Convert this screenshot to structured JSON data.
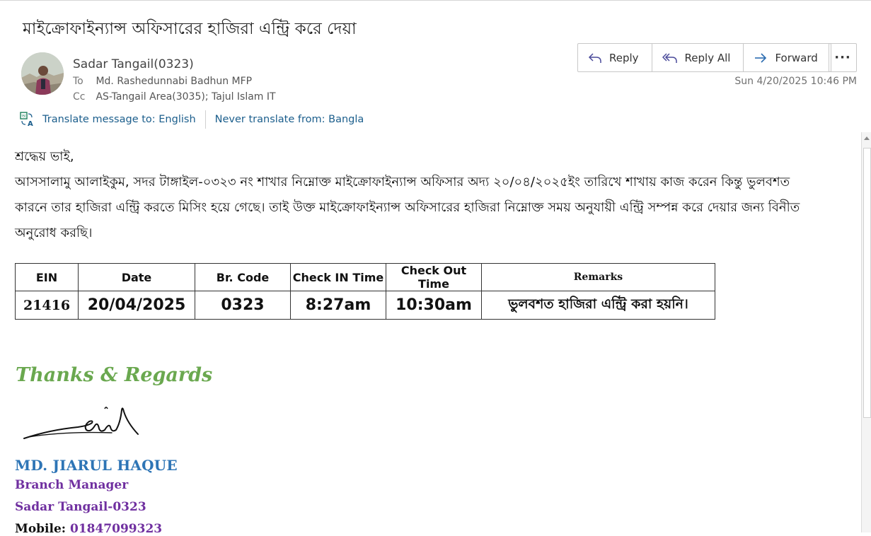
{
  "email": {
    "subject": "মাইক্রোফাইন্যান্স অফিসারের হাজিরা এন্ট্রি করে দেয়া",
    "sender": "Sadar Tangail(0323)",
    "to_label": "To",
    "to_value": "Md. Rashedunnabi Badhun MFP",
    "cc_label": "Cc",
    "cc_value": "AS-Tangail Area(3035); Tajul Islam IT",
    "date": "Sun 4/20/2025 10:46 PM"
  },
  "actions": {
    "reply": "Reply",
    "reply_all": "Reply All",
    "forward": "Forward",
    "more": "···"
  },
  "translate": {
    "translate_to": "Translate message to: English",
    "never_translate": "Never translate from: Bangla"
  },
  "body": {
    "greeting": "শ্রদ্ধেয় ভাই,",
    "line1": "আসসালামু আলাইকুম, সদর টাঙ্গাইল-০৩২৩ নং শাখার নিম্নোক্ত মাইক্রোফাইন্যান্স অফিসার অদ্য ২০/০৪/২০২৫ইং তারিখে শাখায় কাজ করেন কিন্তু ভুলবশত",
    "line2": "কারনে তার হাজিরা এন্ট্রি করতে মিসিং হয়ে গেছে। তাই উক্ত মাইক্রোফাইন্যান্স অফিসারের হাজিরা নিম্নোক্ত সময় অনুযায়ী এন্ট্রি সম্পন্ন করে দেয়ার জন্য বিনীত",
    "line3": "অনুরোধ করছি।"
  },
  "table": {
    "headers": {
      "ein": "EIN",
      "date": "Date",
      "br_code": "Br. Code",
      "check_in": "Check IN Time",
      "check_out": "Check Out Time",
      "remarks": "Remarks"
    },
    "row": {
      "ein": "21416",
      "date": "20/04/2025",
      "br_code": "0323",
      "check_in": "8:27am",
      "check_out": "10:30am",
      "remarks": "ভুলবশত হাজিরা এন্ট্রি করা হয়নি।"
    }
  },
  "signature": {
    "thanks": "Thanks & Regards",
    "name": "MD. JIARUL HAQUE",
    "title": "Branch Manager",
    "branch": "Sadar Tangail-0323",
    "mobile_label": "Mobile:",
    "mobile": "01847099323"
  },
  "colors": {
    "link_blue": "#1b5e8c",
    "thanks_green": "#6aa84f",
    "name_blue": "#2e75b6",
    "signature_purple": "#7030a0"
  },
  "icons": {
    "reply": "reply-arrow-icon",
    "reply_all": "reply-all-arrow-icon",
    "forward": "forward-arrow-icon",
    "more": "more-horizontal-icon",
    "translate": "translate-icon"
  }
}
